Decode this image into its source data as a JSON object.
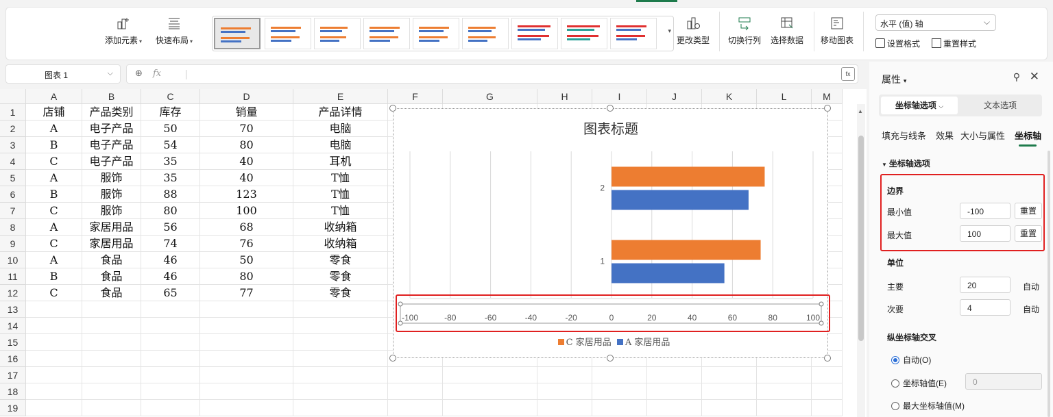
{
  "ribbon": {
    "add_element": "添加元素",
    "quick_layout": "快速布局",
    "change_type": "更改类型",
    "switch_rowcol": "切换行列",
    "select_data": "选择数据",
    "move_chart": "移动图表",
    "axis_dropdown": "水平 (值) 轴",
    "set_format": "设置格式",
    "reset_style": "重置样式"
  },
  "formula_bar": {
    "name_box": "图表 1",
    "fx_symbol": "fx"
  },
  "sheet": {
    "columns": [
      "A",
      "B",
      "C",
      "D",
      "E",
      "F",
      "G",
      "H",
      "I",
      "J",
      "K",
      "L",
      "M"
    ],
    "rows": [
      "1",
      "2",
      "3",
      "4",
      "5",
      "6",
      "7",
      "8",
      "9",
      "10",
      "11",
      "12",
      "13",
      "14",
      "15",
      "16",
      "17",
      "18",
      "19"
    ],
    "data": [
      [
        "店铺",
        "产品类别",
        "库存",
        "销量",
        "产品详情"
      ],
      [
        "A",
        "电子产品",
        "50",
        "70",
        "电脑"
      ],
      [
        "B",
        "电子产品",
        "54",
        "80",
        "电脑"
      ],
      [
        "C",
        "电子产品",
        "35",
        "40",
        "耳机"
      ],
      [
        "A",
        "服饰",
        "35",
        "40",
        "T恤"
      ],
      [
        "B",
        "服饰",
        "88",
        "123",
        "T恤"
      ],
      [
        "C",
        "服饰",
        "80",
        "100",
        "T恤"
      ],
      [
        "A",
        "家居用品",
        "56",
        "68",
        "收纳箱"
      ],
      [
        "C",
        "家居用品",
        "74",
        "76",
        "收纳箱"
      ],
      [
        "A",
        "食品",
        "46",
        "50",
        "零食"
      ],
      [
        "B",
        "食品",
        "46",
        "80",
        "零食"
      ],
      [
        "C",
        "食品",
        "65",
        "77",
        "零食"
      ]
    ]
  },
  "chart_data": {
    "type": "bar",
    "orientation": "horizontal",
    "title": "图表标题",
    "categories": [
      "1",
      "2"
    ],
    "series": [
      {
        "name": "C 家居用品",
        "values": [
          74,
          76
        ],
        "color": "#ed7d31"
      },
      {
        "name": "A 家居用品",
        "values": [
          56,
          68
        ],
        "color": "#4472c4"
      }
    ],
    "xlim": [
      -100,
      100
    ],
    "xticks": [
      "-100",
      "-80",
      "-60",
      "-40",
      "-20",
      "0",
      "20",
      "40",
      "60",
      "80",
      "100"
    ],
    "grid": true,
    "legend_position": "bottom"
  },
  "pane": {
    "title": "属性",
    "tab_axis_options": "坐标轴选项",
    "tab_text_options": "文本选项",
    "subtabs": [
      "填充与线条",
      "效果",
      "大小与属性",
      "坐标轴"
    ],
    "section_axis_options": "坐标轴选项",
    "bounds": "边界",
    "min_label": "最小值",
    "min_value": "-100",
    "max_label": "最大值",
    "max_value": "100",
    "reset": "重置",
    "units": "单位",
    "major_label": "主要",
    "major_value": "20",
    "minor_label": "次要",
    "minor_value": "4",
    "auto": "自动",
    "cross_title": "纵坐标轴交叉",
    "radio_auto": "自动(O)",
    "radio_axis_value": "坐标轴值(E)",
    "axis_value_input": "0",
    "radio_max": "最大坐标轴值(M)"
  },
  "colors": {
    "accent_green": "#1e7b4c",
    "highlight_red": "#e02020",
    "orange": "#ed7d31",
    "blue": "#4472c4"
  }
}
